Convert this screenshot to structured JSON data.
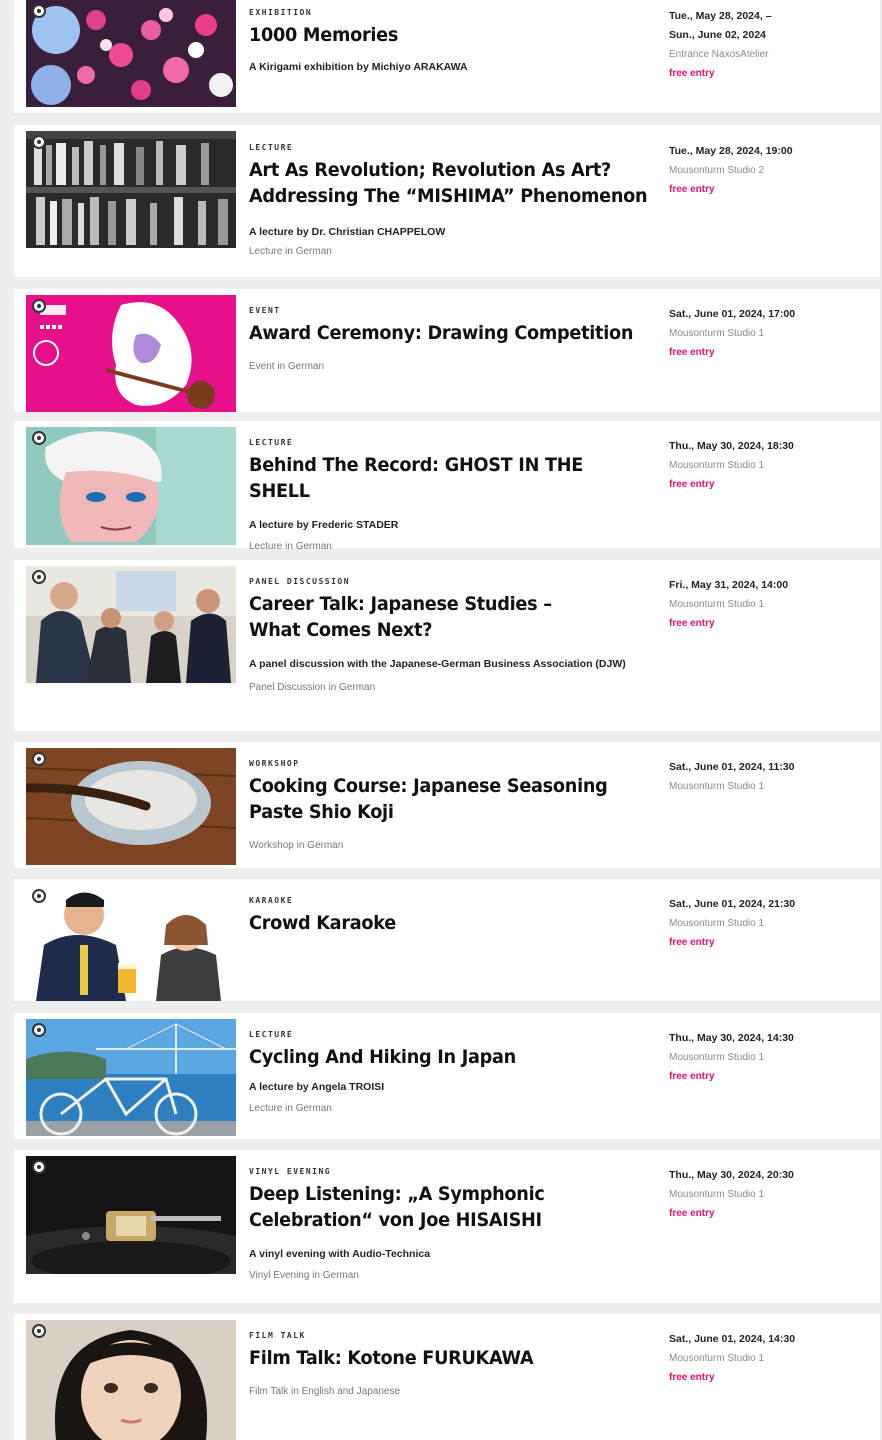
{
  "events": [
    {
      "category": "EXHIBITION",
      "title": "1000 Memories",
      "subtitle": "A Kirigami exhibition by Michiyo ARAKAWA",
      "language": "",
      "date": "Tue., May 28, 2024, –\nSun., June 02, 2024",
      "venue": "Entrance NaxosAtelier",
      "entry": "free entry"
    },
    {
      "category": "LECTURE",
      "title": "Art As Revolution; Revolution As Art? Addressing The “MISHIMA” Phenomenon",
      "subtitle": "A lecture by Dr. Christian CHAPPELOW",
      "language": "Lecture in German",
      "date": "Tue., May 28, 2024, 19:00",
      "venue": "Mousonturm Studio 2",
      "entry": "free entry"
    },
    {
      "category": "EVENT",
      "title": "Award Ceremony: Drawing Competition",
      "subtitle": "",
      "language": "Event in German",
      "date": "Sat., June 01, 2024, 17:00",
      "venue": "Mousonturm Studio 1",
      "entry": "free entry"
    },
    {
      "category": "LECTURE",
      "title": "Behind The Record: GHOST IN THE SHELL",
      "subtitle": "A lecture by Frederic STADER",
      "language": "Lecture in German",
      "date": "Thu., May 30, 2024, 18:30",
      "venue": "Mousonturm Studio 1",
      "entry": "free entry"
    },
    {
      "category": "PANEL DISCUSSION",
      "title": "Career Talk: Japanese Studies – What Comes Next?",
      "subtitle": "A panel discussion with the Japanese-German Business Association (DJW)",
      "language": "Panel Discussion in German",
      "date": "Fri., May 31, 2024, 14:00",
      "venue": "Mousonturm Studio 1",
      "entry": "free entry"
    },
    {
      "category": "WORKSHOP",
      "title": "Cooking Course: Japanese Seasoning Paste Shio Koji",
      "subtitle": "",
      "language": "Workshop in German",
      "date": "Sat., June 01, 2024, 11:30",
      "venue": "Mousonturm Studio 1",
      "entry": ""
    },
    {
      "category": "KARAOKE",
      "title": "Crowd Karaoke",
      "subtitle": "",
      "language": "",
      "date": "Sat., June 01, 2024, 21:30",
      "venue": "Mousonturm Studio 1",
      "entry": "free entry"
    },
    {
      "category": "LECTURE",
      "title": "Cycling And Hiking In Japan",
      "subtitle": "A lecture by Angela TROISI",
      "language": "Lecture in German",
      "date": "Thu., May 30, 2024, 14:30",
      "venue": "Mousonturm Studio 1",
      "entry": "free entry"
    },
    {
      "category": "VINYL EVENING",
      "title": "Deep Listening: „A Symphonic Celebration“ von Joe HISAISHI",
      "subtitle": "A vinyl evening with Audio-Technica",
      "language": "Vinyl Evening in German",
      "date": "Thu., May 30, 2024, 20:30",
      "venue": "Mousonturm Studio 1",
      "entry": "free entry"
    },
    {
      "category": "FILM TALK",
      "title": "Film Talk: Kotone FURUKAWA",
      "subtitle": "",
      "language": "Film Talk in English and Japanese",
      "date": "Sat., June 01, 2024, 14:30",
      "venue": "Mousonturm Studio 1",
      "entry": "free entry"
    }
  ],
  "colors": {
    "accent": "#e8106e",
    "card": "#ffffff",
    "page": "#eeeeee"
  },
  "icons": {
    "bookmark": "bookmark-icon"
  }
}
